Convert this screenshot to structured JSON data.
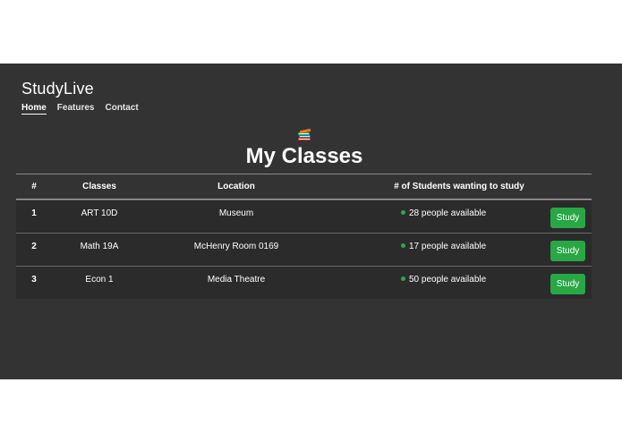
{
  "app": {
    "brand": "StudyLive"
  },
  "nav": {
    "items": [
      {
        "label": "Home",
        "active": true
      },
      {
        "label": "Features",
        "active": false
      },
      {
        "label": "Contact",
        "active": false
      }
    ]
  },
  "page": {
    "title": "My Classes",
    "icon": "books-icon"
  },
  "table": {
    "headers": [
      "#",
      "Classes",
      "Location",
      "# of Students wanting to study"
    ],
    "rows": [
      {
        "num": "1",
        "class": "ART 10D",
        "location": "Museum",
        "students": "28 people available",
        "action": "Study"
      },
      {
        "num": "2",
        "class": "Math 19A",
        "location": "McHenry Room 0169",
        "students": "17 people available",
        "action": "Study"
      },
      {
        "num": "3",
        "class": "Econ 1",
        "location": "Media Theatre",
        "students": "50 people available",
        "action": "Study"
      }
    ]
  },
  "colors": {
    "background": "#333333",
    "accent": "#28a745",
    "status_dot": "#2fa84a"
  }
}
